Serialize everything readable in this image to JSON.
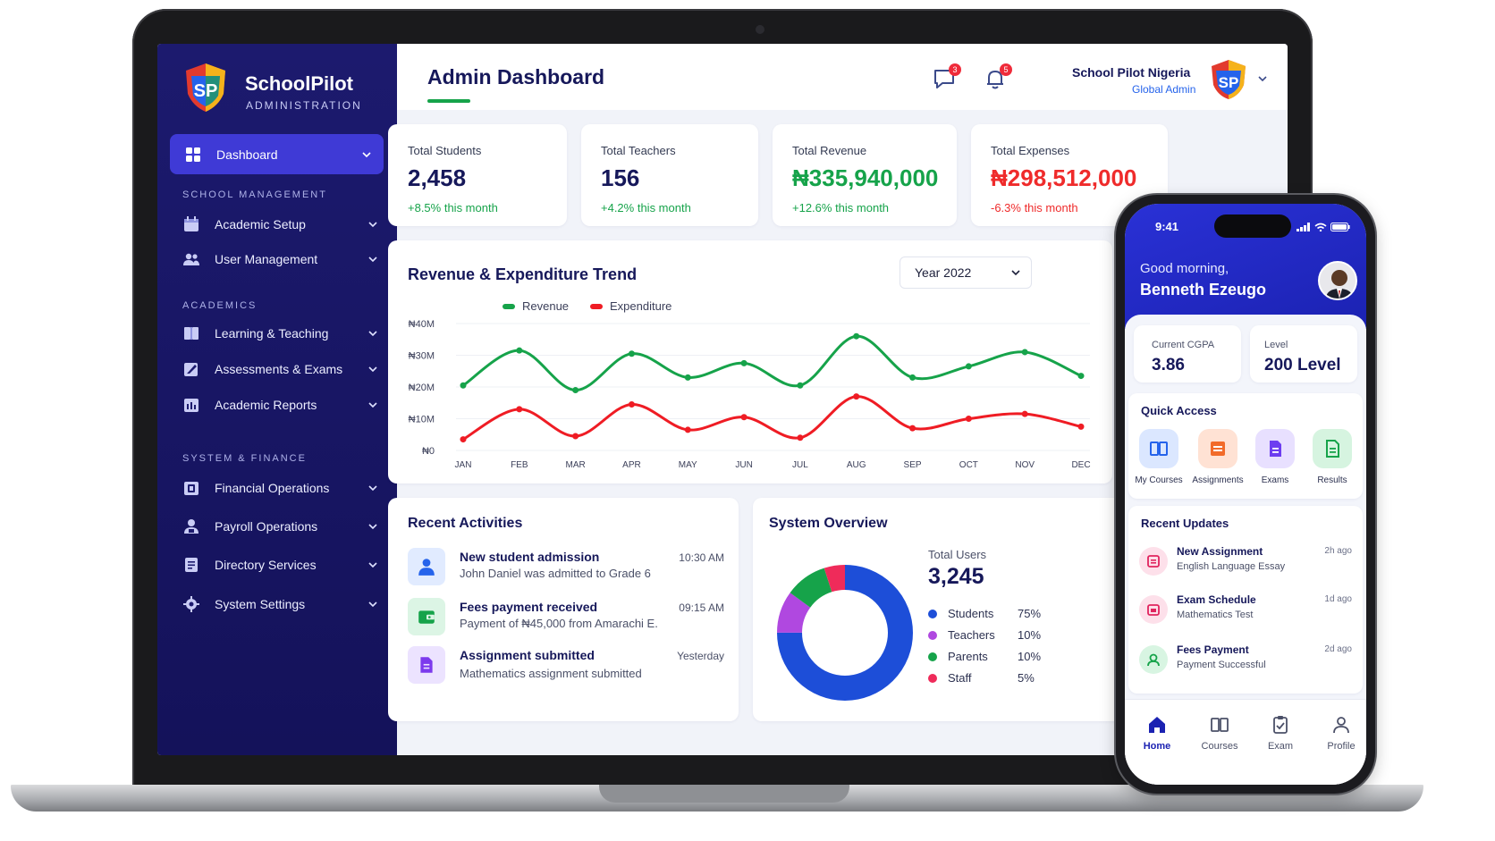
{
  "brand": {
    "name": "SchoolPilot",
    "subtitle": "ADMINISTRATION",
    "logo_text": "SP"
  },
  "sidebar": {
    "active": {
      "label": "Dashboard",
      "icon": "grid-icon"
    },
    "sections": [
      {
        "title": "SCHOOL MANAGEMENT",
        "items": [
          {
            "label": "Academic Setup",
            "icon": "calendar-icon"
          },
          {
            "label": "User Management",
            "icon": "users-icon"
          }
        ]
      },
      {
        "title": "ACADEMICS",
        "items": [
          {
            "label": "Learning & Teaching",
            "icon": "book-icon"
          },
          {
            "label": "Assessments & Exams",
            "icon": "edit-icon"
          },
          {
            "label": "Academic Reports",
            "icon": "report-icon"
          }
        ]
      },
      {
        "title": "SYSTEM & FINANCE",
        "items": [
          {
            "label": "Financial Operations",
            "icon": "finance-icon"
          },
          {
            "label": "Payroll Operations",
            "icon": "payroll-icon"
          },
          {
            "label": "Directory Services",
            "icon": "directory-icon"
          },
          {
            "label": "System Settings",
            "icon": "gear-icon"
          }
        ]
      }
    ]
  },
  "header": {
    "title": "Admin Dashboard",
    "messages_badge": "3",
    "notifications_badge": "5",
    "org_name": "School Pilot Nigeria",
    "org_role": "Global Admin"
  },
  "stats": [
    {
      "label": "Total Students",
      "value": "2,458",
      "delta": "+8.5% this month"
    },
    {
      "label": "Total Teachers",
      "value": "156",
      "delta": "+4.2% this month"
    },
    {
      "label": "Total Revenue",
      "value": "₦335,940,000",
      "delta": "+12.6% this month"
    },
    {
      "label": "Total Expenses",
      "value": "₦298,512,000",
      "delta": "-6.3% this month"
    }
  ],
  "trend": {
    "title": "Revenue & Expenditure Trend",
    "year_select": "Year 2022"
  },
  "chart_data": {
    "type": "line",
    "categories": [
      "JAN",
      "FEB",
      "MAR",
      "APR",
      "MAY",
      "JUN",
      "JUL",
      "AUG",
      "SEP",
      "OCT",
      "NOV",
      "DEC"
    ],
    "series": [
      {
        "name": "Revenue",
        "color": "#16a34a",
        "values": [
          20.5,
          31.5,
          19,
          30.5,
          23,
          27.5,
          20.5,
          36,
          23,
          26.5,
          31,
          23.5
        ]
      },
      {
        "name": "Expenditure",
        "color": "#ef1c24",
        "values": [
          3.5,
          13,
          4.5,
          14.5,
          6.5,
          10.5,
          4,
          17,
          7,
          10,
          11.5,
          7.5
        ]
      }
    ],
    "y_ticks": [
      "₦0",
      "₦10M",
      "₦20M",
      "₦30M",
      "₦40M"
    ],
    "ylim": [
      0,
      40
    ],
    "legend_position": "top-left"
  },
  "activities": {
    "title": "Recent Activities",
    "items": [
      {
        "title": "New student admission",
        "desc": "John Daniel was admitted to Grade 6",
        "time": "10:30 AM",
        "icon": "user-icon"
      },
      {
        "title": "Fees payment received",
        "desc": "Payment of ₦45,000 from Amarachi E.",
        "time": "09:15 AM",
        "icon": "wallet-icon"
      },
      {
        "title": "Assignment submitted",
        "desc": "Mathematics assignment submitted",
        "time": "Yesterday",
        "icon": "document-icon"
      }
    ]
  },
  "overview": {
    "title": "System Overview",
    "total_label": "Total Users",
    "total_value": "3,245",
    "rows": [
      {
        "label": "Students",
        "pct": "75%",
        "value": 75,
        "color": "#1d4ed8"
      },
      {
        "label": "Teachers",
        "pct": "10%",
        "value": 10,
        "color": "#b048e0"
      },
      {
        "label": "Parents",
        "pct": "10%",
        "value": 10,
        "color": "#16a34a"
      },
      {
        "label": "Staff",
        "pct": "5%",
        "value": 5,
        "color": "#ef2b5a"
      }
    ]
  },
  "phone": {
    "time": "9:41",
    "greeting": "Good morning,",
    "name": "Benneth Ezeugo",
    "cgpa_label": "Current CGPA",
    "cgpa_value": "3.86",
    "level_label": "Level",
    "level_value": "200 Level",
    "quick_title": "Quick Access",
    "quick": [
      {
        "label": "My Courses",
        "icon": "book-icon"
      },
      {
        "label": "Assignments",
        "icon": "assignment-icon"
      },
      {
        "label": "Exams",
        "icon": "exam-icon"
      },
      {
        "label": "Results",
        "icon": "results-icon"
      }
    ],
    "updates_title": "Recent Updates",
    "updates": [
      {
        "title": "New Assignment",
        "desc": "English Language Essay",
        "time": "2h ago"
      },
      {
        "title": "Exam Schedule",
        "desc": "Mathematics Test",
        "time": "1d ago"
      },
      {
        "title": "Fees Payment",
        "desc": "Payment Successful",
        "time": "2d ago"
      }
    ],
    "nav": [
      "Home",
      "Courses",
      "Exam",
      "Profile"
    ]
  }
}
